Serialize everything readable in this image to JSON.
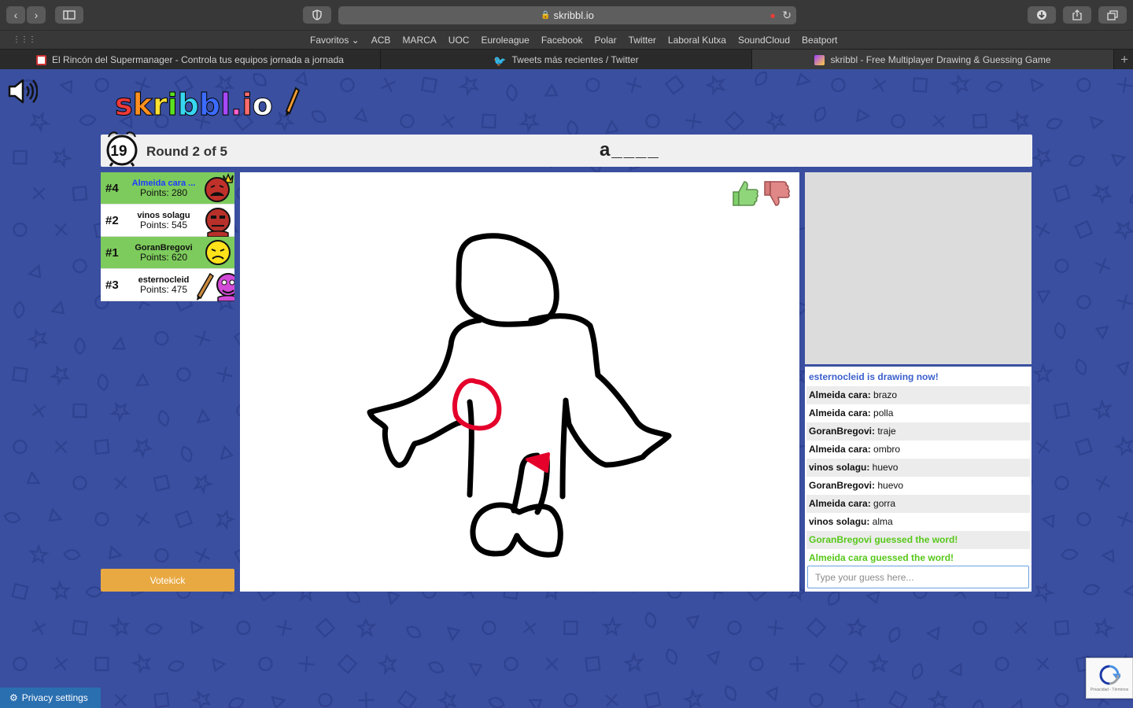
{
  "browser": {
    "url": "skribbl.io",
    "favorites": [
      "Favoritos ⌄",
      "ACB",
      "MARCA",
      "UOC",
      "Euroleague",
      "Facebook",
      "Polar",
      "Twitter",
      "Laboral Kutxa",
      "SoundCloud",
      "Beatport"
    ],
    "tabs": [
      {
        "label": "El Rincón del Supermanager - Controla tus equipos jornada a jornada",
        "active": false
      },
      {
        "label": "Tweets más recientes / Twitter",
        "active": false
      },
      {
        "label": "skribbl - Free Multiplayer Drawing & Guessing Game",
        "active": true
      }
    ]
  },
  "game": {
    "logo": "skribbl.io",
    "timer": "19",
    "round": "Round 2 of 5",
    "word_hint": "a____",
    "players": [
      {
        "rank": "#4",
        "name": "Almeida cara ...",
        "points": "Points: 280",
        "guessed": true,
        "is_me": true,
        "crown": true
      },
      {
        "rank": "#2",
        "name": "vinos solagu",
        "points": "Points: 545",
        "guessed": false,
        "is_me": false
      },
      {
        "rank": "#1",
        "name": "GoranBregovi",
        "points": "Points: 620",
        "guessed": true,
        "is_me": false
      },
      {
        "rank": "#3",
        "name": "esternocleid",
        "points": "Points: 475",
        "guessed": false,
        "is_me": false,
        "drawing": true
      }
    ],
    "votekick": "Votekick"
  },
  "chat": {
    "messages": [
      {
        "type": "sys-blue",
        "text": "esternocleid is drawing now!"
      },
      {
        "type": "msg",
        "who": "Almeida cara:",
        "text": " brazo"
      },
      {
        "type": "msg",
        "who": "Almeida cara:",
        "text": " polla"
      },
      {
        "type": "msg",
        "who": "GoranBregovi:",
        "text": " traje"
      },
      {
        "type": "msg",
        "who": "Almeida cara:",
        "text": " ombro"
      },
      {
        "type": "msg",
        "who": "vinos solagu:",
        "text": " huevo"
      },
      {
        "type": "msg",
        "who": "GoranBregovi:",
        "text": " huevo"
      },
      {
        "type": "msg",
        "who": "Almeida cara:",
        "text": " gorra"
      },
      {
        "type": "msg",
        "who": "vinos solagu:",
        "text": " alma"
      },
      {
        "type": "sys-green",
        "text": "GoranBregovi guessed the word!"
      },
      {
        "type": "sys-green",
        "text": "Almeida cara guessed the word!"
      }
    ],
    "input_placeholder": "Type your guess here..."
  },
  "footer": {
    "privacy": "Privacy settings",
    "recaptcha": "Privacidad - Términos"
  },
  "colors": {
    "page_bg": "#3a4fa0",
    "guessed_row": "#7dcb5c",
    "votekick": "#e9a942",
    "system_blue": "#3a5fcd",
    "system_green": "#57c81a"
  }
}
